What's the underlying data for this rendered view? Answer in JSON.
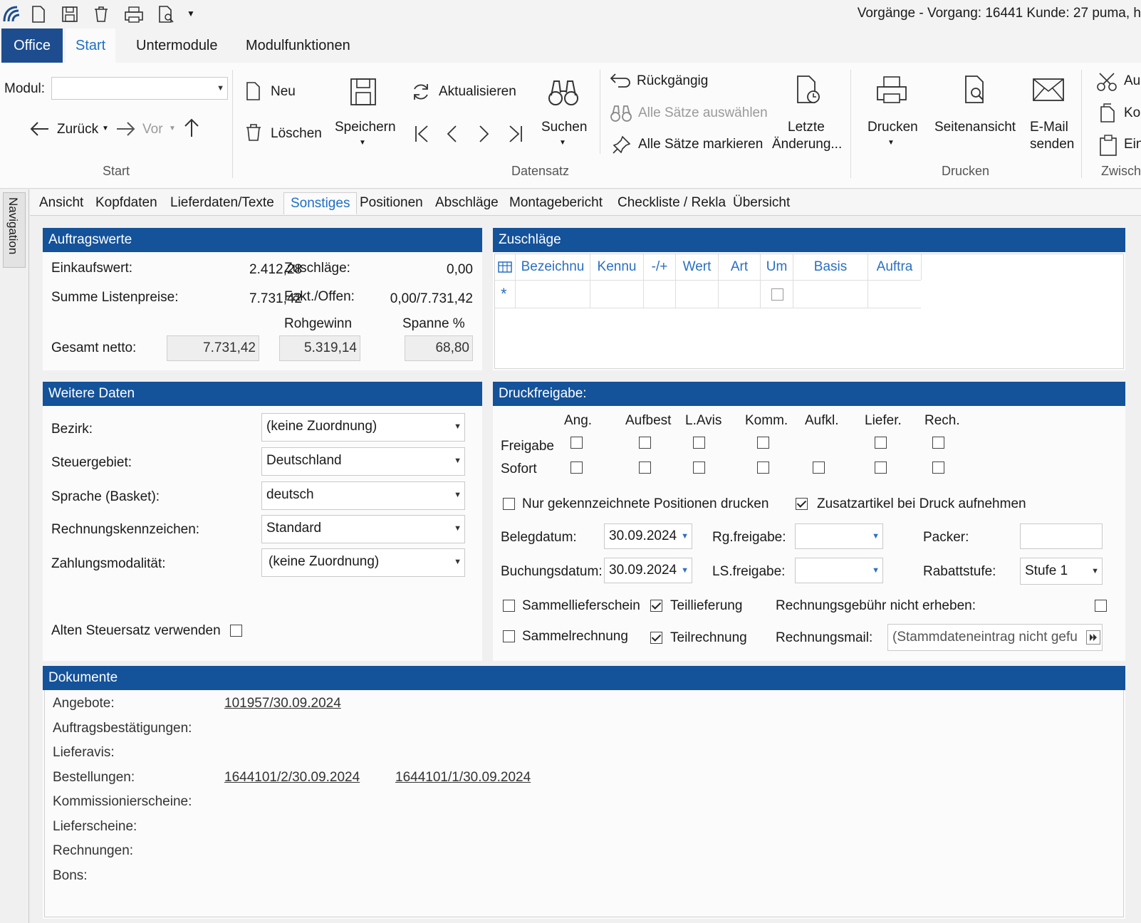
{
  "window": {
    "title": "Vorgänge - Vorgang: 16441 Kunde: 27 puma, h"
  },
  "ribbon_tabs": [
    "Office",
    "Start",
    "Untermodule",
    "Modulfunktionen"
  ],
  "ribbon": {
    "modul_label": "Modul:",
    "modul_value": "",
    "back": "Zurück",
    "forward": "Vor",
    "group_start": "Start",
    "neu": "Neu",
    "loeschen": "Löschen",
    "speichern": "Speichern",
    "aktualisieren": "Aktualisieren",
    "suchen": "Suchen",
    "group_datensatz": "Datensatz",
    "rueckgaengig": "Rückgängig",
    "alle_auswaehlen": "Alle Sätze auswählen",
    "alle_markieren": "Alle Sätze markieren",
    "letzte_1": "Letzte",
    "letzte_2": "Änderung...",
    "drucken": "Drucken",
    "seitenansicht": "Seitenansicht",
    "email_1": "E-Mail",
    "email_2": "senden",
    "group_drucken": "Drucken",
    "cut": "Au",
    "copy": "Ko",
    "paste": "Ein",
    "group_zwisch": "Zwisch"
  },
  "nav_label": "Navigation",
  "inner_tabs": [
    "Ansicht",
    "Kopfdaten",
    "Lieferdaten/Texte",
    "Sonstiges",
    "Positionen",
    "Abschläge",
    "Montagebericht",
    "Checkliste / Rekla",
    "Übersicht"
  ],
  "auftragswerte": {
    "title": "Auftragswerte",
    "einkaufswert_label": "Einkaufswert:",
    "einkaufswert": "2.412,28",
    "zuschlaege_label": "Zuschläge:",
    "zuschlaege": "0,00",
    "summe_label": "Summe Listenpreise:",
    "summe": "7.731,42",
    "fakt_label": "Fakt./Offen:",
    "fakt": "0,00/7.731,42",
    "rohgewinn_label": "Rohgewinn",
    "spanne_label": "Spanne %",
    "gesamt_label": "Gesamt netto:",
    "gesamt": "7.731,42",
    "rohgewinn": "5.319,14",
    "spanne": "68,80"
  },
  "zuschlaege_grid": {
    "title": "Zuschläge",
    "columns": [
      "Bezeichnu",
      "Kennu",
      "-/+",
      "Wert",
      "Art",
      "Um",
      "Basis",
      "Auftra"
    ],
    "new_row_marker": "*"
  },
  "weitere_daten": {
    "title": "Weitere Daten",
    "bezirk_label": "Bezirk:",
    "bezirk": "(keine Zuordnung)",
    "steuer_label": "Steuergebiet:",
    "steuer": "Deutschland",
    "sprache_label": "Sprache (Basket):",
    "sprache": "deutsch",
    "rk_label": "Rechnungskennzeichen:",
    "rk": "Standard",
    "zm_label": "Zahlungsmodalität:",
    "zm": "(keine Zuordnung)",
    "alten_label": "Alten Steuersatz verwenden"
  },
  "druckfreigabe": {
    "title": "Druckfreigabe:",
    "columns": [
      "Ang.",
      "Aufbest",
      "L.Avis",
      "Komm.",
      "Aufkl.",
      "Liefer.",
      "Rech."
    ],
    "freigabe_label": "Freigabe",
    "sofort_label": "Sofort",
    "nur_label": "Nur gekennzeichnete Positionen drucken",
    "zusatz_label": "Zusatzartikel bei Druck aufnehmen",
    "belegdatum_label": "Belegdatum:",
    "belegdatum": "30.09.2024",
    "rgfreigabe_label": "Rg.freigabe:",
    "packer_label": "Packer:",
    "buchungsdatum_label": "Buchungsdatum:",
    "buchungsdatum": "30.09.2024",
    "lsfreigabe_label": "LS.freigabe:",
    "rabatt_label": "Rabattstufe:",
    "rabatt": "Stufe 1",
    "sammells_label": "Sammellieferschein",
    "teillief_label": "Teillieferung",
    "gebuehr_label": "Rechnungsgebühr nicht erheben:",
    "sammelre_label": "Sammelrechnung",
    "teilre_label": "Teilrechnung",
    "mail_label": "Rechnungsmail:",
    "mail": "(Stammdateneintrag nicht gefu"
  },
  "dokumente": {
    "title": "Dokumente",
    "angebote_label": "Angebote:",
    "angebote_1": "101957/30.09.2024",
    "ab_label": "Auftragsbestätigungen:",
    "lieferavis_label": "Lieferavis:",
    "bestellungen_label": "Bestellungen:",
    "bestellung_1": "1644101/2/30.09.2024",
    "bestellung_2": "1644101/1/30.09.2024",
    "komm_label": "Kommissionierscheine:",
    "ls_label": "Lieferscheine:",
    "rechnungen_label": "Rechnungen:",
    "bons_label": "Bons:"
  }
}
